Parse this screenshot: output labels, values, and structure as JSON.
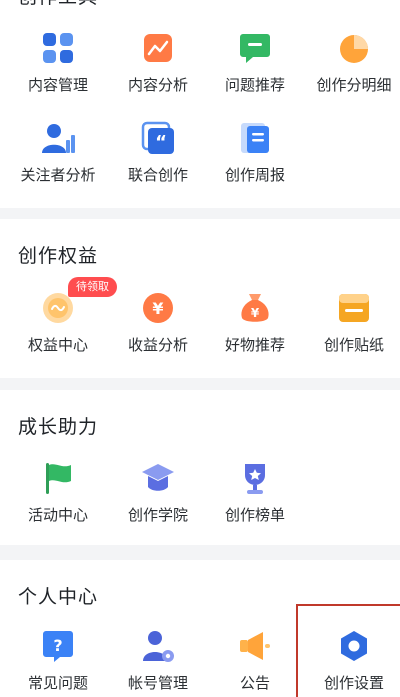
{
  "sections": {
    "tools": {
      "title": "创作工具",
      "items": [
        {
          "label": "内容管理",
          "icon": "grid-icon",
          "color": "#2f6bdf"
        },
        {
          "label": "内容分析",
          "icon": "trend-chart-icon",
          "color": "#ff7a45"
        },
        {
          "label": "问题推荐",
          "icon": "chat-bubble-icon",
          "color": "#33b864"
        },
        {
          "label": "创作分明细",
          "icon": "pie-chart-icon",
          "color": "#ffa43a"
        },
        {
          "label": "关注者分析",
          "icon": "user-chart-icon",
          "color": "#2f6bdf"
        },
        {
          "label": "联合创作",
          "icon": "quote-icon",
          "color": "#2f6bdf"
        },
        {
          "label": "创作周报",
          "icon": "report-icon",
          "color": "#3b82f6"
        }
      ]
    },
    "benefits": {
      "title": "创作权益",
      "badge": "待领取",
      "items": [
        {
          "label": "权益中心",
          "icon": "benefit-badge-icon",
          "color": "#ffc46b"
        },
        {
          "label": "收益分析",
          "icon": "yuan-coin-icon",
          "color": "#ff7a45"
        },
        {
          "label": "好物推荐",
          "icon": "money-bag-icon",
          "color": "#ff7a45"
        },
        {
          "label": "创作贴纸",
          "icon": "sticker-icon",
          "color": "#f5a623"
        }
      ]
    },
    "growth": {
      "title": "成长助力",
      "items": [
        {
          "label": "活动中心",
          "icon": "flag-icon",
          "color": "#33b864"
        },
        {
          "label": "创作学院",
          "icon": "graduation-cap-icon",
          "color": "#5b6ee1"
        },
        {
          "label": "创作榜单",
          "icon": "trophy-icon",
          "color": "#5b6ee1"
        }
      ]
    },
    "personal": {
      "title": "个人中心",
      "items": [
        {
          "label": "常见问题",
          "icon": "question-icon",
          "color": "#3b82f6"
        },
        {
          "label": "帐号管理",
          "icon": "user-settings-icon",
          "color": "#4b63d8"
        },
        {
          "label": "公告",
          "icon": "megaphone-icon",
          "color": "#ffa43a"
        },
        {
          "label": "创作设置",
          "icon": "hexagon-settings-icon",
          "color": "#2f6bdf"
        }
      ]
    }
  },
  "colors": {
    "background": "#f3f4f6",
    "card": "#ffffff",
    "highlight": "#c0392b",
    "badge": "#ff4d4f"
  }
}
